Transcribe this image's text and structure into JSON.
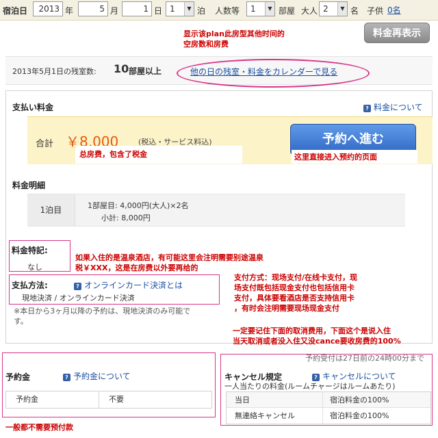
{
  "search_bar": {
    "checkin_label": "宿泊日",
    "year_value": "2013",
    "year_unit": "年",
    "month_value": "5",
    "month_unit": "月",
    "day_value": "1",
    "day_unit": "日",
    "nights_value": "1",
    "nights_unit": "泊",
    "people_label": "人数等",
    "rooms_value": "1",
    "rooms_label": "部屋",
    "adults_label": "大人",
    "adults_value": "2",
    "adults_unit": "名",
    "children_label": "子供",
    "children_link": "0名"
  },
  "recalc_button": "料金再表示",
  "availability": {
    "label": "2013年5月1日の残室数:",
    "count": "10",
    "unit": "部屋以上",
    "calendar_link": "他の日の残室・料金をカレンダーで見る"
  },
  "payment": {
    "title": "支払い料金",
    "fee_help_link": "料金について",
    "total_label": "合計",
    "total_amount": "￥8,000",
    "total_note": "(税込・サービス料込)",
    "book_button": "予約へ進む"
  },
  "breakdown": {
    "title": "料金明細",
    "night_label": "1泊目",
    "line1": "1部屋目: 4,000円(大人)×2名",
    "line2": "小計: 8,000円"
  },
  "special": {
    "title": "料金特記:",
    "value": "なし"
  },
  "payment_method": {
    "title": "支払方法:",
    "help_link": "オンラインカード決済とは",
    "value": "現地決済 / オンラインカード決済",
    "note_line1": "※本日から3ヶ月以降の予約は、現地決済のみ可能で",
    "note_line2": "す。"
  },
  "booking_deadline": "予約受付は27日前の24時00分まで",
  "deposit": {
    "title": "予約金",
    "help_link": "予約金について",
    "row_label": "予約金",
    "row_value": "不要"
  },
  "cancellation": {
    "title": "キャンセル規定",
    "help_link": "キャンセルについて",
    "subtitle": "一人当たりの料金(ルームチャージはルームあたり)",
    "rows": [
      {
        "label": "当日",
        "value": "宿泊料金の100%"
      },
      {
        "label": "無連絡キャンセル",
        "value": "宿泊料金の100%"
      }
    ]
  },
  "annotations": {
    "plan_other_dates_line1": "显示该plan此房型其他时间的",
    "plan_other_dates_line2": "空房数和房费",
    "total_fee": "总房费，包含了税金",
    "book_here": "这里直接进入预约的页面",
    "onsen_line1": "如果入住的是温泉酒店，有可能这里会注明需要别途温泉",
    "onsen_line2": "税￥XXX，这是在房费以外要再给的",
    "payment_line1": "支付方式：现场支付/在线卡支付，现",
    "payment_line2": "场支付既包括现金支付也包括信用卡",
    "payment_line3": "支付，具体要看酒店是否支持信用卡",
    "payment_line4": "，有时会注明需要现场现金支付",
    "cancel_line1": "一定要记住下面的取消费用，下面这个是说入住",
    "cancel_line2": "当天取消或者没入住又没cance要收房费的100%",
    "deposit_note": "一般都不需要预付款"
  },
  "colors": {
    "annotation_red": "#cc0000",
    "annotation_pink": "#d6348a",
    "link_blue": "#1a4fa0",
    "price_orange": "#e8590c",
    "book_button_blue": "#2f66c3"
  }
}
